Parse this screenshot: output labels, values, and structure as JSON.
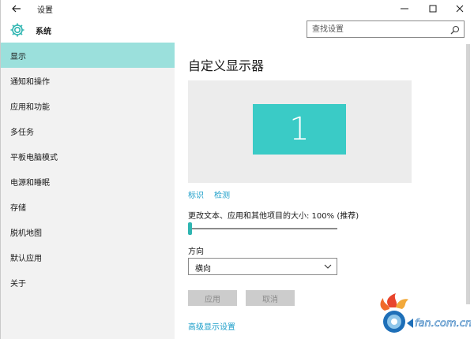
{
  "window": {
    "title": "设置"
  },
  "header": {
    "title": "系统",
    "icon": "gear-icon",
    "search": {
      "placeholder": "查找设置",
      "value": ""
    }
  },
  "sidebar": {
    "items": [
      {
        "label": "显示",
        "active": true
      },
      {
        "label": "通知和操作",
        "active": false
      },
      {
        "label": "应用和功能",
        "active": false
      },
      {
        "label": "多任务",
        "active": false
      },
      {
        "label": "平板电脑模式",
        "active": false
      },
      {
        "label": "电源和睡眠",
        "active": false
      },
      {
        "label": "存储",
        "active": false
      },
      {
        "label": "脱机地图",
        "active": false
      },
      {
        "label": "默认应用",
        "active": false
      },
      {
        "label": "关于",
        "active": false
      }
    ]
  },
  "main": {
    "title": "自定义显示器",
    "monitor_number": "1",
    "identify_label": "标识",
    "detect_label": "检测",
    "scale_label": "更改文本、应用和其他项目的大小: 100% (推荐)",
    "scale_slider_fraction": 0,
    "orientation_label": "方向",
    "orientation_value": "横向",
    "apply_label": "应用",
    "cancel_label": "取消",
    "advanced_label": "高级显示设置"
  },
  "watermark": {
    "text": "fan.com.cn"
  },
  "colors": {
    "accent": "#3acbc6",
    "sidebar_active": "#9be0dc",
    "link": "#1b9ec9",
    "sidebar_bg": "#f2f2f2",
    "preview_bg": "#ececec",
    "disabled_button": "#cccccc"
  }
}
